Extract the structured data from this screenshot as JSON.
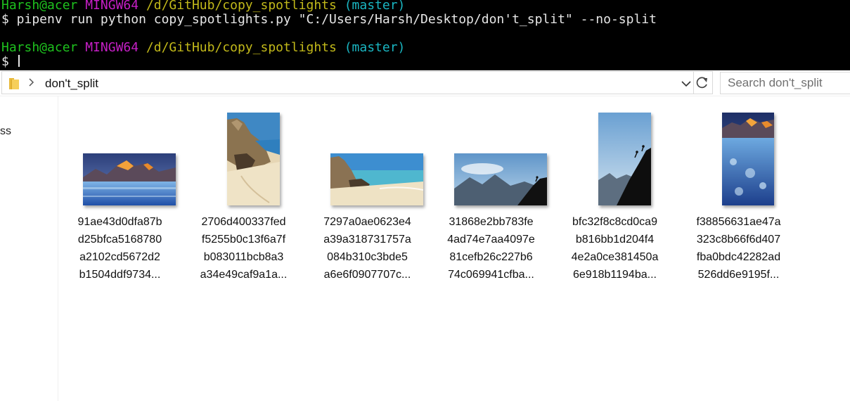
{
  "terminal": {
    "prompt1": {
      "user": "Harsh@acer",
      "env": "MINGW64",
      "path": "/d/GitHub/copy_spotlights",
      "branch": "(master)"
    },
    "command": "$ pipenv run python copy_spotlights.py \"C:/Users/Harsh/Desktop/don't_split\" --no-split",
    "prompt2": {
      "user": "Harsh@acer",
      "env": "MINGW64",
      "path": "/d/GitHub/copy_spotlights",
      "branch": "(master)"
    },
    "input_prefix": "$ "
  },
  "explorer": {
    "breadcrumb": "don't_split",
    "search_placeholder": "Search don't_split",
    "nav_item": "ss",
    "files": [
      {
        "lines": [
          "91ae43d0dfa87b",
          "d25bfca5168780",
          "a2102cd5672d2",
          "b1504ddf9734..."
        ],
        "thumb": "mountain-lake-landscape"
      },
      {
        "lines": [
          "2706d400337fed",
          "f5255b0c13f6a7f",
          "b083011bcb8a3",
          "a34e49caf9a1a..."
        ],
        "thumb": "beach-ruins-portrait"
      },
      {
        "lines": [
          "7297a0ae0623e4",
          "a39a318731757a",
          "084b310c3bde5",
          "a6e6f0907707c..."
        ],
        "thumb": "beach-ruins-landscape"
      },
      {
        "lines": [
          "31868e2bb783fe",
          "4ad74e7aa4097e",
          "81cefb26c227b6",
          "74c069941cfba..."
        ],
        "thumb": "climbers-mountains-landscape"
      },
      {
        "lines": [
          "bfc32f8c8cd0ca9",
          "b816bb1d204f4",
          "4e2a0ce381450a",
          "6e918b1194ba..."
        ],
        "thumb": "climbers-mountains-portrait"
      },
      {
        "lines": [
          "f38856631ae47a",
          "323c8b66f6d407",
          "fba0bdc42282ad",
          "526dd6e9195f..."
        ],
        "thumb": "mountain-lake-portrait"
      }
    ]
  }
}
